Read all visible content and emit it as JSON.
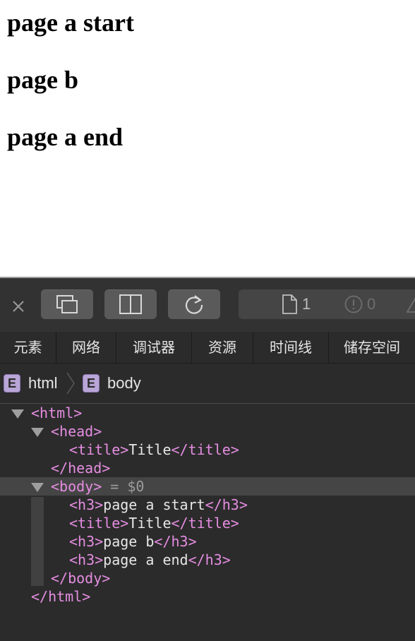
{
  "page": {
    "headings": [
      "page a start",
      "page b",
      "page a end"
    ]
  },
  "toolbar": {
    "resource_count": "1",
    "error_count": "0"
  },
  "tabs": [
    "元素",
    "网络",
    "调试器",
    "资源",
    "时间线",
    "储存空间"
  ],
  "breadcrumb": {
    "items": [
      "html",
      "body"
    ],
    "badge_letter": "E"
  },
  "dom_tree": {
    "html_open": "<html>",
    "head_open": "<head>",
    "title_open": "<title>",
    "title_text": "Title",
    "title_close": "</title>",
    "head_close": "</head>",
    "body_open": "<body>",
    "body_suffix": " = $0",
    "h3_open": "<h3>",
    "h3_close": "</h3>",
    "h3_1_text": "page a start",
    "h3_2_text": "page b",
    "h3_3_text": "page a end",
    "body_close": "</body>",
    "html_close": "</html>"
  },
  "colors": {
    "tag": "#e58de1",
    "panel_bg": "#2b2b2b",
    "selected_row": "#454545",
    "badge": "#b9a5d6"
  }
}
